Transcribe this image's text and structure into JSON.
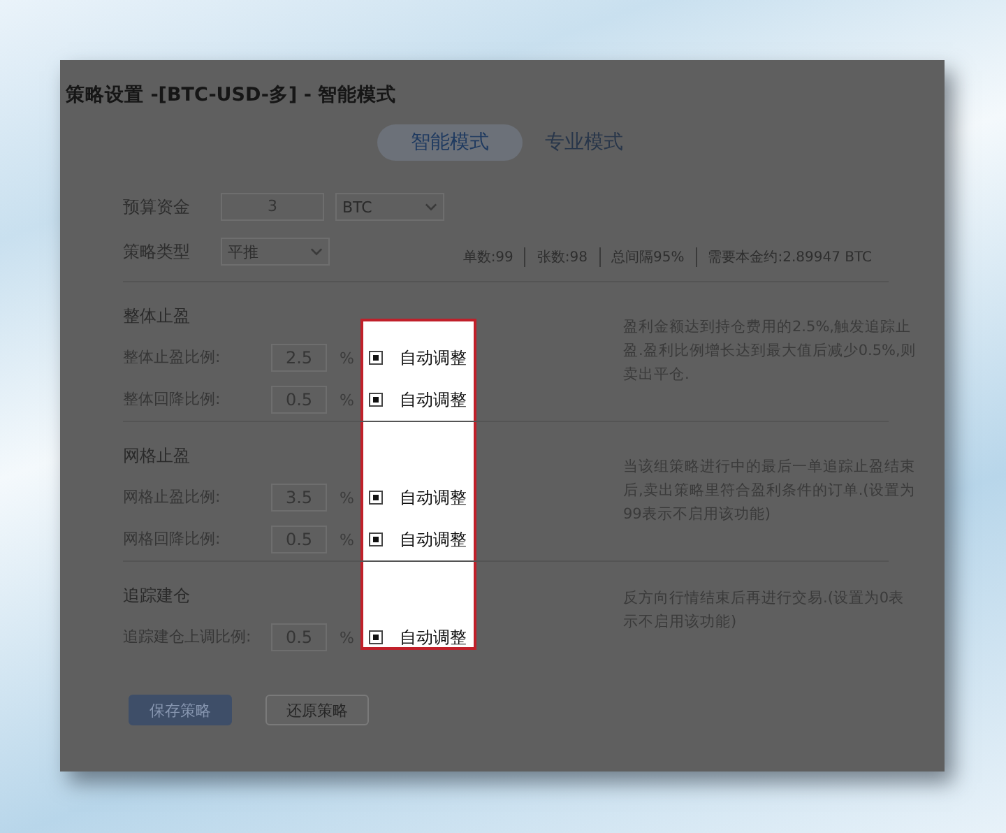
{
  "dialog": {
    "title": "策略设置 -[BTC-USD-多] - 智能模式"
  },
  "tabs": [
    {
      "label": "智能模式",
      "selected": true
    },
    {
      "label": "专业模式",
      "selected": false
    }
  ],
  "budget": {
    "label": "预算资金",
    "value": "3",
    "unit": "BTC"
  },
  "strategy_type": {
    "label": "策略类型",
    "value": "平推"
  },
  "stats": [
    "单数:99",
    "张数:98",
    "总间隔95%",
    "需要本金约:2.89947 BTC"
  ],
  "sections": [
    {
      "title": "整体止盈",
      "rows": [
        {
          "label": "整体止盈比例:",
          "value": "2.5",
          "unit": "%",
          "auto_adjust": {
            "label": "自动调整",
            "checked": true
          }
        },
        {
          "label": "整体回降比例:",
          "value": "0.5",
          "unit": "%",
          "auto_adjust": {
            "label": "自动调整",
            "checked": true
          }
        }
      ],
      "description": "盈利金额达到持仓费用的2.5%,触发追踪止盈.盈利比例增长达到最大值后减少0.5%,则卖出平仓."
    },
    {
      "title": "网格止盈",
      "rows": [
        {
          "label": "网格止盈比例:",
          "value": "3.5",
          "unit": "%",
          "auto_adjust": {
            "label": "自动调整",
            "checked": true
          }
        },
        {
          "label": "网格回降比例:",
          "value": "0.5",
          "unit": "%",
          "auto_adjust": {
            "label": "自动调整",
            "checked": true
          }
        }
      ],
      "description": "当该组策略进行中的最后一单追踪止盈结束后,卖出策略里符合盈利条件的订单.(设置为99表示不启用该功能)"
    },
    {
      "title": "追踪建仓",
      "rows": [
        {
          "label": "追踪建仓上调比例:",
          "value": "0.5",
          "unit": "%",
          "auto_adjust": {
            "label": "自动调整",
            "checked": true
          }
        }
      ],
      "description": "反方向行情结束后再进行交易.(设置为0表示不启用该功能)"
    }
  ],
  "buttons": [
    {
      "label": "保存策略",
      "kind": "primary"
    },
    {
      "label": "还原策略",
      "kind": "secondary"
    }
  ]
}
